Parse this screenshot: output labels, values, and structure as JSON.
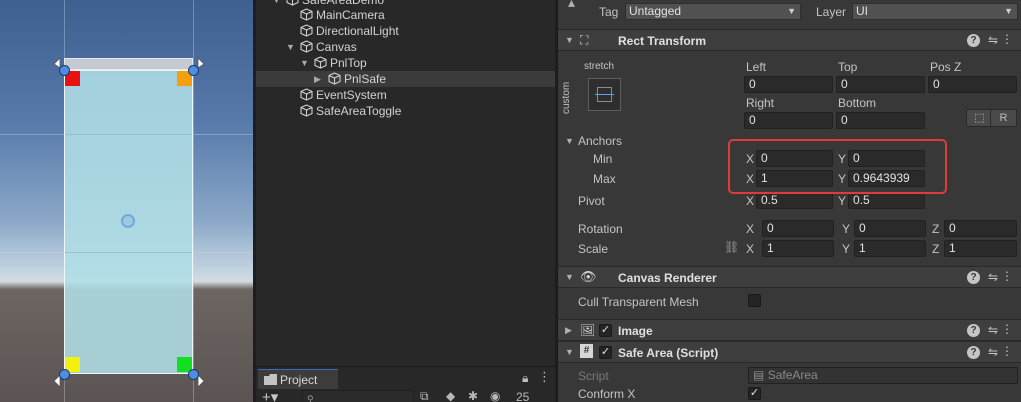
{
  "hierarchy": {
    "items": [
      {
        "label": "SafeAreaDemo",
        "has_arrow": true,
        "expanded": true,
        "indent": 0
      },
      {
        "label": "MainCamera",
        "has_arrow": false,
        "indent": 1
      },
      {
        "label": "DirectionalLight",
        "has_arrow": false,
        "indent": 1
      },
      {
        "label": "Canvas",
        "has_arrow": true,
        "expanded": true,
        "indent": 1
      },
      {
        "label": "PnlTop",
        "has_arrow": true,
        "expanded": true,
        "indent": 2
      },
      {
        "label": "PnlSafe",
        "has_arrow": true,
        "expanded": false,
        "indent": 3,
        "selected": true
      },
      {
        "label": "EventSystem",
        "has_arrow": false,
        "indent": 1
      },
      {
        "label": "SafeAreaToggle",
        "has_arrow": false,
        "indent": 1
      }
    ]
  },
  "project": {
    "tab_label": "Project",
    "search_placeholder": "",
    "hidden_count": "25"
  },
  "inspector": {
    "tag_label": "Tag",
    "tag_value": "Untagged",
    "layer_label": "Layer",
    "layer_value": "UI",
    "rect_transform": {
      "title": "Rect Transform",
      "stretch_label": "stretch",
      "custom_label": "custom",
      "left_label": "Left",
      "left_value": "0",
      "top_label": "Top",
      "top_value": "0",
      "posz_label": "Pos Z",
      "posz_value": "0",
      "right_label": "Right",
      "right_value": "0",
      "bottom_label": "Bottom",
      "bottom_value": "0",
      "raw_button": "R",
      "anchors_label": "Anchors",
      "min_label": "Min",
      "min_x": "0",
      "min_y": "0",
      "max_label": "Max",
      "max_x": "1",
      "max_y": "0.9643939",
      "pivot_label": "Pivot",
      "pivot_x": "0.5",
      "pivot_y": "0.5",
      "rotation_label": "Rotation",
      "rot_x": "0",
      "rot_y": "0",
      "rot_z": "0",
      "scale_label": "Scale",
      "scale_x": "1",
      "scale_y": "1",
      "scale_z": "1",
      "axis_x": "X",
      "axis_y": "Y",
      "axis_z": "Z"
    },
    "canvas_renderer": {
      "title": "Canvas Renderer",
      "cull_label": "Cull Transparent Mesh",
      "cull_checked": false
    },
    "image": {
      "title": "Image",
      "enabled": true
    },
    "safe_area": {
      "title": "Safe Area (Script)",
      "enabled": true,
      "script_label": "Script",
      "script_value": "SafeArea",
      "conform_x_label": "Conform X",
      "conform_x_checked": true
    }
  },
  "colors": {
    "selection_highlight": "#e03b3b",
    "handle_blue": "#4f8de0",
    "corner_red": "#e81010",
    "corner_orange": "#f5a00a",
    "corner_yellow": "#f3f010",
    "corner_green": "#10e020"
  }
}
